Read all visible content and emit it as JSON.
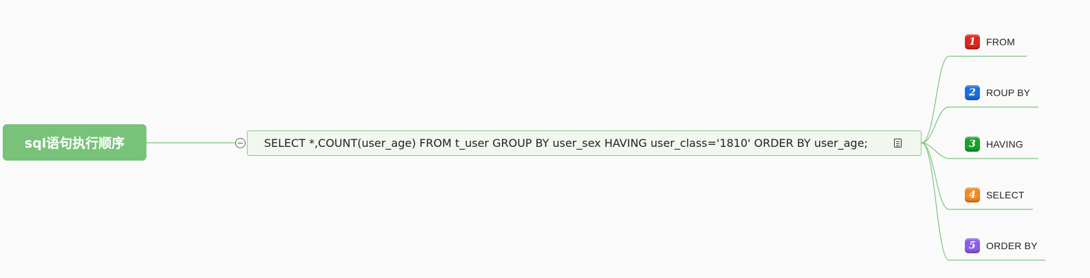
{
  "root": {
    "label": "sql语句执行顺序"
  },
  "main": {
    "label": "SELECT *,COUNT(user_age) FROM t_user  GROUP BY user_sex HAVING user_class='1810' ORDER BY user_age;"
  },
  "steps": [
    {
      "number": "1",
      "label": "FROM",
      "color": "#e0261d"
    },
    {
      "number": "2",
      "label": "ROUP BY",
      "color": "#1d6fe0"
    },
    {
      "number": "3",
      "label": "HAVING",
      "color": "#18a32a"
    },
    {
      "number": "4",
      "label": "SELECT",
      "color": "#f08c26"
    },
    {
      "number": "5",
      "label": "ORDER BY",
      "color": "#8c5ee8"
    }
  ],
  "colors": {
    "connector": "#7cc47a"
  }
}
